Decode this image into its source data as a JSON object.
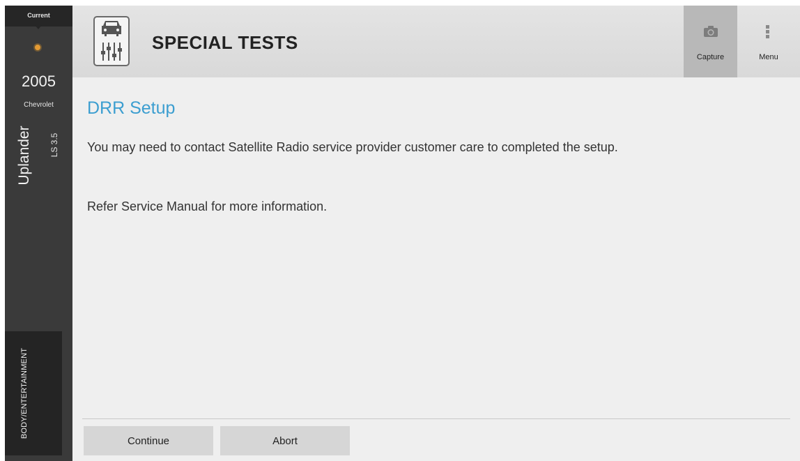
{
  "sidebar": {
    "current_label": "Current",
    "year": "2005",
    "make": "Chevrolet",
    "model": "Uplander",
    "trim": "LS 3.5",
    "category": "BODY/ENTERTAINMENT",
    "status_color": "#e39a34"
  },
  "header": {
    "title": "SPECIAL TESTS",
    "icon": "car-diagnostic-icon",
    "capture_label": "Capture",
    "capture_icon": "camera-icon",
    "menu_label": "Menu",
    "menu_icon": "vertical-dots-icon"
  },
  "content": {
    "title": "DRR Setup",
    "title_color": "#3c9ed0",
    "message1": "You may need to contact Satellite Radio service provider customer care to completed the setup.",
    "message2": "Refer Service Manual for more information."
  },
  "footer": {
    "continue_label": "Continue",
    "abort_label": "Abort"
  }
}
